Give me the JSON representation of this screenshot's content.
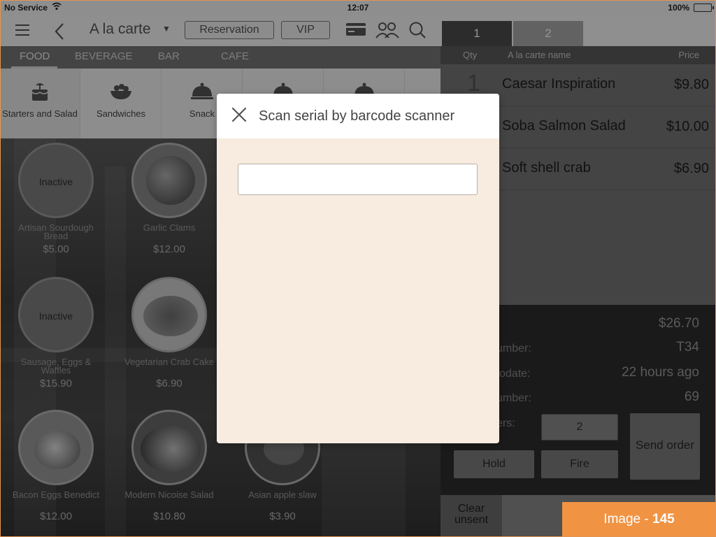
{
  "status_bar": {
    "carrier": "No Service",
    "time": "12:07",
    "battery": "100%"
  },
  "header": {
    "menu_title": "A la carte",
    "reservation_label": "Reservation",
    "vip_label": "VIP"
  },
  "order_tabs": [
    "1",
    "2"
  ],
  "categories": [
    "FOOD",
    "BEVERAGE",
    "BAR",
    "CAFE"
  ],
  "subcategories": [
    {
      "label": "Starters and Salad",
      "icon": "cake-icon"
    },
    {
      "label": "Sandwiches",
      "icon": "bowl-icon"
    },
    {
      "label": "Snack",
      "icon": "cloche-icon"
    }
  ],
  "products": [
    {
      "name": "Artisan Sourdough Bread",
      "price": "$5.00",
      "status": "Inactive"
    },
    {
      "name": "Garlic Clams",
      "price": "$12.00",
      "status": ""
    },
    {
      "name": "Sausage, Eggs & Waffles",
      "price": "$15.90",
      "status": "Inactive"
    },
    {
      "name": "Vegetarian Crab Cake",
      "price": "$6.90",
      "status": ""
    },
    {
      "name": "Bacon Eggs Benedict",
      "price": "$12.00",
      "status": ""
    },
    {
      "name": "Modern Nicoise Salad",
      "price": "$10.80",
      "status": ""
    },
    {
      "name": "Asian apple slaw",
      "price": "$3.90",
      "status": ""
    }
  ],
  "order": {
    "columns": {
      "qty": "Qty",
      "name": "A la carte name",
      "price": "Price"
    },
    "items": [
      {
        "qty": "1",
        "name": "Caesar Inspiration",
        "price": "$9.80"
      },
      {
        "qty": "",
        "name": "Soba Salmon Salad",
        "price": "$10.00"
      },
      {
        "qty": "",
        "name": "Soft shell crab",
        "price": "$6.90"
      }
    ],
    "total": "$26.70",
    "table_label": "umber:",
    "table_value": "T34",
    "update_label": "odate:",
    "update_value": "22 hours ago",
    "number_label": "umber:",
    "number_value": "69",
    "guests_label": "ers:",
    "guests_value": "2",
    "send_order_label": "Send order",
    "hold_label": "Hold",
    "fire_label": "Fire",
    "clear_unsent_label": "Clear unsent"
  },
  "badge": {
    "prefix": "Image -",
    "number": "145"
  },
  "modal": {
    "title": "Scan serial by barcode scanner",
    "input_value": "",
    "input_placeholder": ""
  },
  "colors": {
    "badge": "#f09444",
    "modal_body": "#f8ebdf",
    "modal_header": "#ffffff"
  }
}
